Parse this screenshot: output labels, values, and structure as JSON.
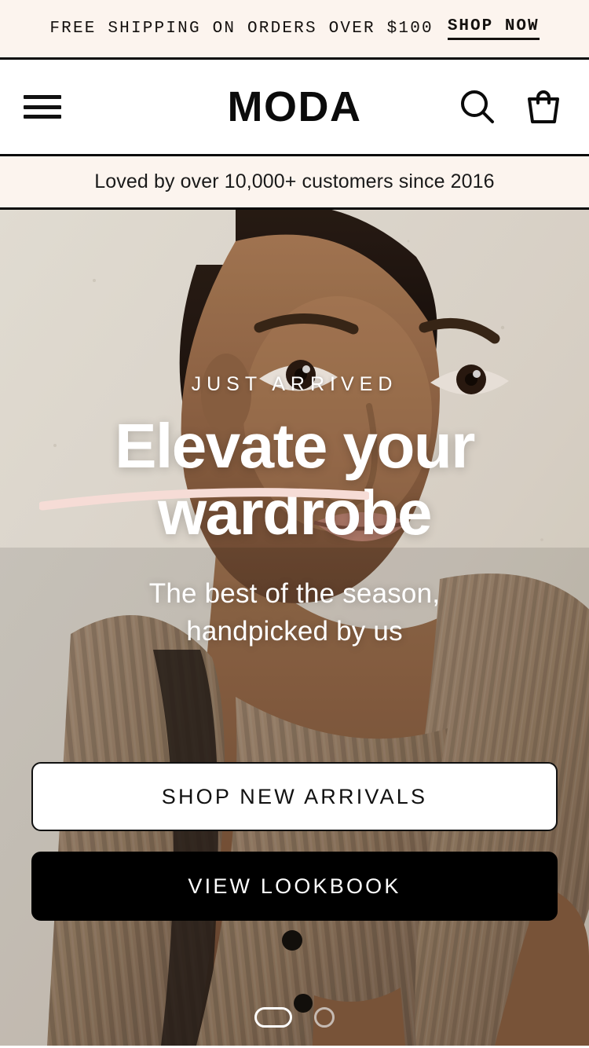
{
  "announcement": {
    "text": "FREE SHIPPING ON ORDERS OVER $100",
    "link_label": "SHOP NOW"
  },
  "header": {
    "logo": "MODA",
    "menu_icon": "hamburger-menu-icon",
    "search_icon": "search-icon",
    "cart_icon": "shopping-bag-icon"
  },
  "trustbar": {
    "text": "Loved by over 10,000+ customers since 2016"
  },
  "hero": {
    "eyebrow": "JUST ARRIVED",
    "headline_line1": "Elevate your",
    "headline_line2": "wardrobe",
    "subhead_line1": "The best of the season,",
    "subhead_line2": "handpicked by us",
    "primary_cta": "SHOP NEW ARRIVALS",
    "secondary_cta": "VIEW LOOKBOOK"
  },
  "carousel": {
    "active_index": 0,
    "slides": 2
  },
  "colors": {
    "cream": "#FCF4EE",
    "ink": "#0A0A0A",
    "white": "#FFFFFF",
    "brush_pink": "#F6DCD6",
    "hero_wall": "#E8E2D8",
    "hero_knit": "#A98straight"
  }
}
